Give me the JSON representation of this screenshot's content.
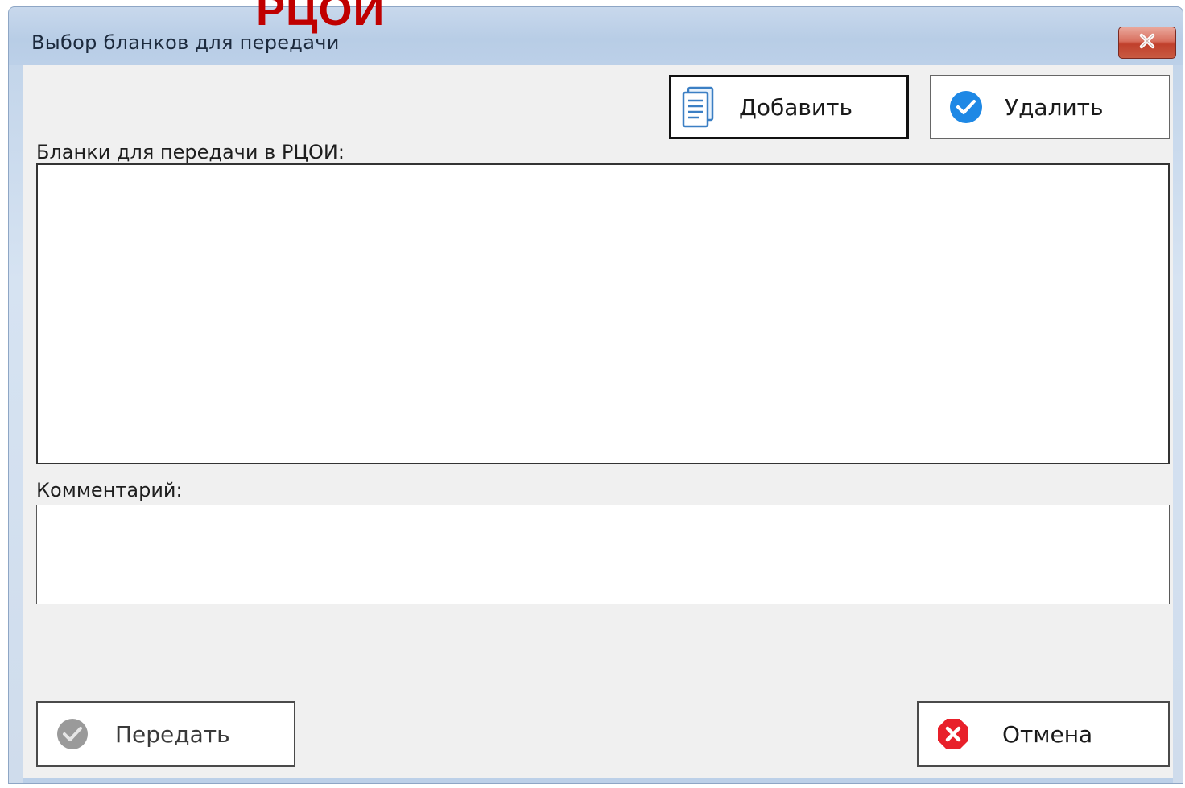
{
  "overlay": {
    "title": "РЦОИ"
  },
  "window": {
    "title": "Выбор бланков для передачи",
    "close_icon": "close-x-icon"
  },
  "toolbar": {
    "add_label": "Добавить",
    "add_icon": "document-icon",
    "delete_label": "Удалить",
    "delete_icon": "check-circle-icon"
  },
  "list": {
    "label": "Бланки для передачи в РЦОИ:",
    "items": []
  },
  "comment": {
    "label": "Комментарий:",
    "value": ""
  },
  "footer": {
    "send_label": "Передать",
    "send_icon": "check-circle-gray-icon",
    "cancel_label": "Отмена",
    "cancel_icon": "cancel-x-circle-icon"
  },
  "colors": {
    "overlay_title": "#c00000",
    "delete_icon": "#1e88e5",
    "cancel_icon": "#e8202a",
    "send_icon": "#9a9a9a"
  }
}
